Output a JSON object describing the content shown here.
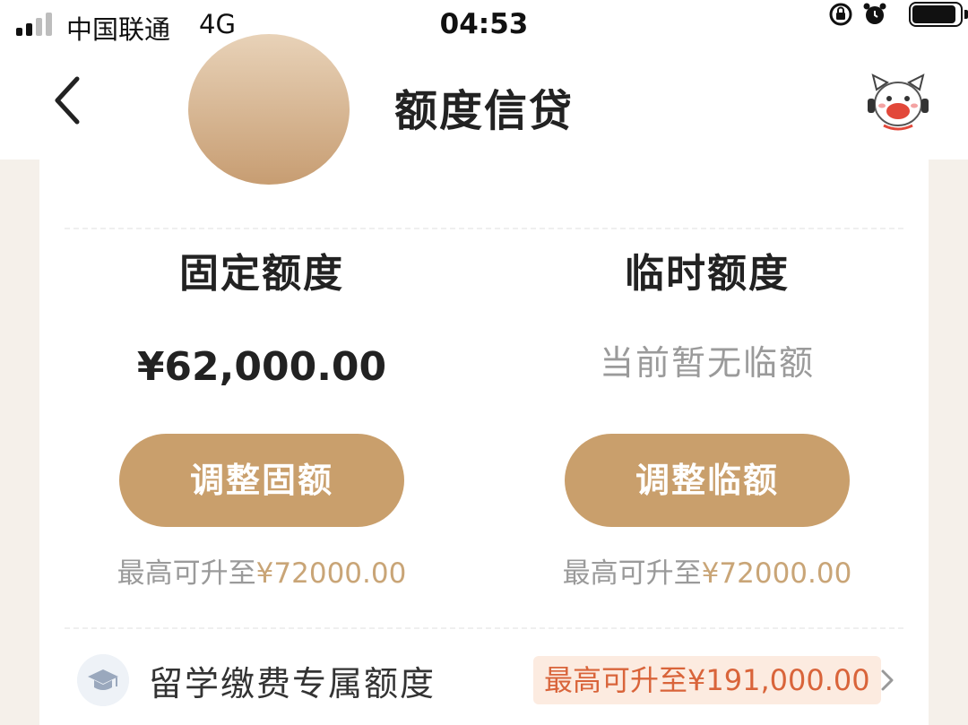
{
  "status_bar": {
    "carrier": "中国联通",
    "network": "4G",
    "time": "04:53"
  },
  "nav": {
    "title": "额度信贷"
  },
  "fixed": {
    "title": "固定额度",
    "amount": "¥62,000.00",
    "button_label": "调整固额",
    "max_prefix": "最高可升至",
    "max_value": "¥72000.00"
  },
  "temporary": {
    "title": "临时额度",
    "status": "当前暂无临额",
    "button_label": "调整临额",
    "max_prefix": "最高可升至",
    "max_value": "¥72000.00"
  },
  "study_abroad": {
    "label": "留学缴费专属额度",
    "limit_text": "最高可升至¥191,000.00"
  },
  "colors": {
    "accent_gold": "#c99f6c",
    "badge_red": "#d9643a"
  }
}
